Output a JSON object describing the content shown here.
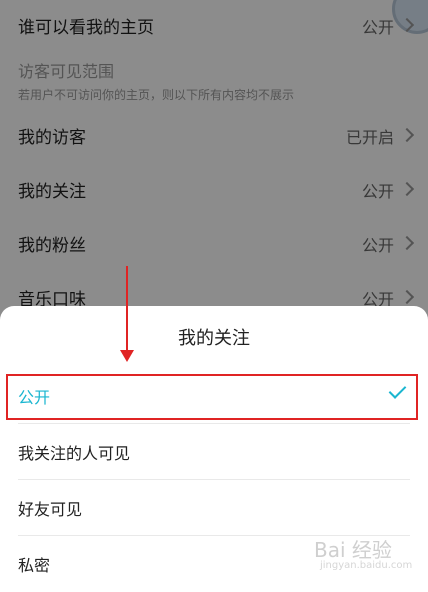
{
  "settings": {
    "who_can_view_title": "谁可以看我的主页",
    "who_can_view_value": "公开",
    "visitor_scope_title": "访客可见范围",
    "visitor_scope_desc": "若用户不可访问你的主页，则以下所有内容均不展示",
    "rows": [
      {
        "title": "我的访客",
        "value": "已开启"
      },
      {
        "title": "我的关注",
        "value": "公开"
      },
      {
        "title": "我的粉丝",
        "value": "公开"
      },
      {
        "title": "音乐口味",
        "value": "公开"
      }
    ]
  },
  "sheet": {
    "title": "我的关注",
    "options": [
      "公开",
      "我关注的人可见",
      "好友可见",
      "私密"
    ],
    "selected_index": 0
  },
  "watermark": {
    "logo": "Bai 经验",
    "sub": "jingyan.baidu.com"
  },
  "colors": {
    "accent": "#1ab6d0",
    "annotation": "#e02424"
  }
}
